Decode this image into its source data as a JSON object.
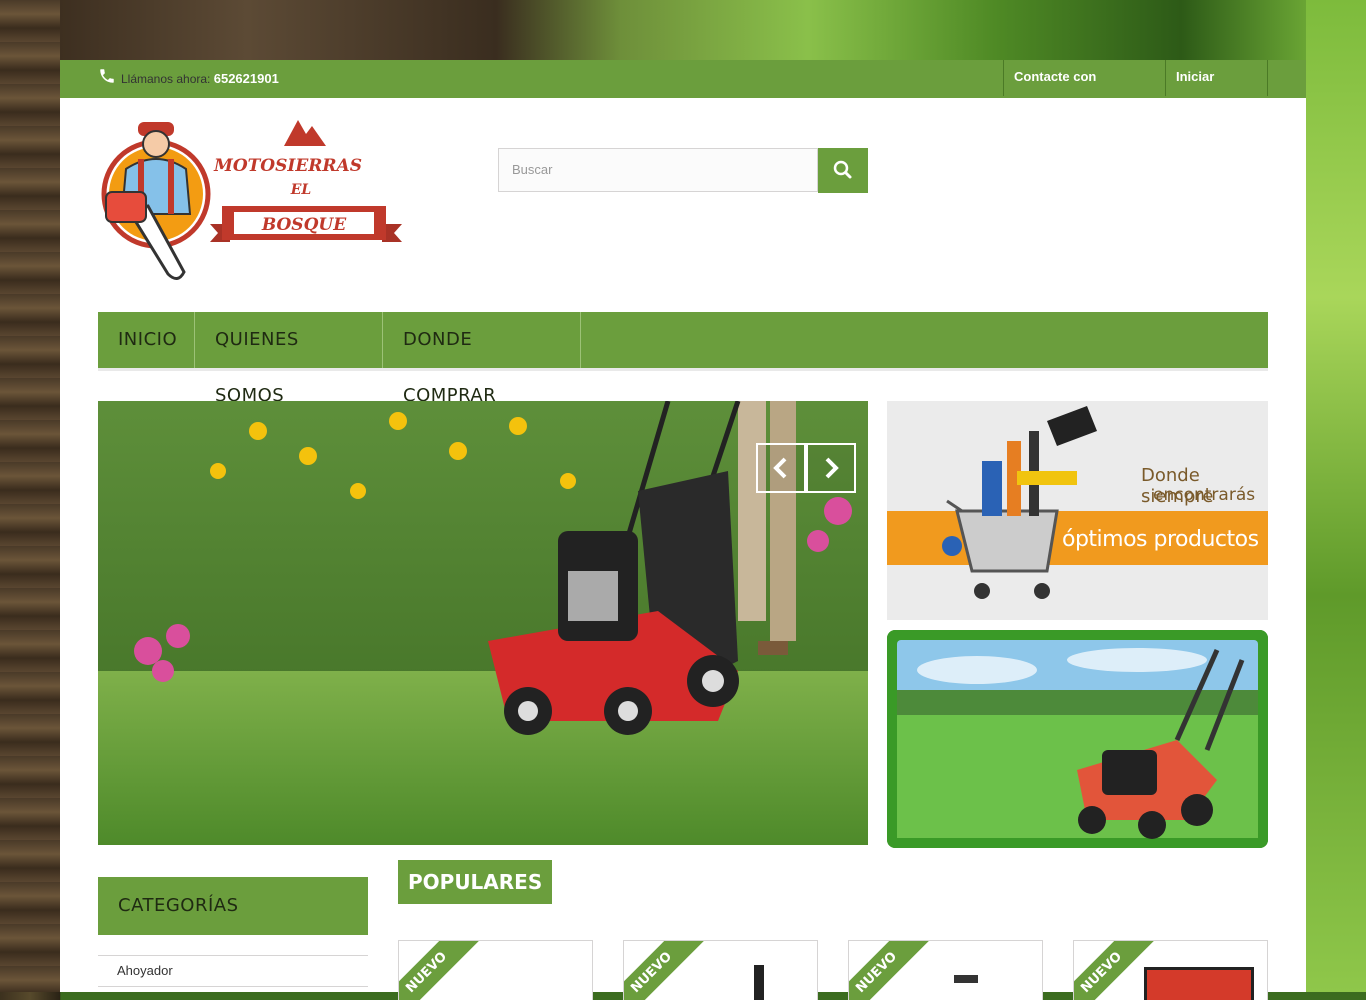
{
  "topbar": {
    "call_label": "Llámanos ahora:",
    "call_number": "652621901",
    "contact_link": "Contacte con nosotros",
    "login_link": "Iniciar sesión"
  },
  "logo": {
    "line1": "MOTOSIERRAS",
    "line2": "EL",
    "line3": "BOSQUE"
  },
  "search": {
    "placeholder": "Buscar"
  },
  "nav": {
    "items": [
      "INICIO",
      "QUIENES SOMOS",
      "DONDE COMPRAR"
    ]
  },
  "banner1": {
    "line1": "Donde siempre",
    "line2": "encontrarás",
    "line3": "óptimos productos"
  },
  "categories": {
    "title": "CATEGORÍAS",
    "items": [
      "Ahoyador"
    ]
  },
  "popular": {
    "title": "POPULARES",
    "badge": "NUEVO"
  },
  "colors": {
    "accent": "#6b9e3d",
    "banner_orange": "#f19a1e"
  }
}
